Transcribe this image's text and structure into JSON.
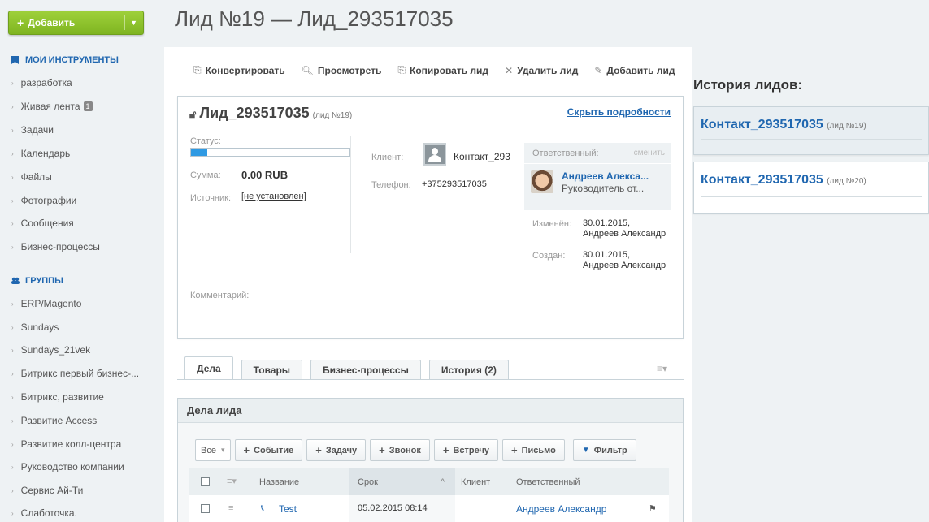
{
  "sidebar": {
    "add_label": "Добавить",
    "my_tools_label": "МОИ ИНСТРУМЕНТЫ",
    "tools": [
      "разработка",
      "Живая лента",
      "Задачи",
      "Календарь",
      "Файлы",
      "Фотографии",
      "Сообщения",
      "Бизнес-процессы"
    ],
    "feed_badge": "1",
    "groups_label": "ГРУППЫ",
    "groups": [
      "ERP/Magento",
      "Sundays",
      "Sundays_21vek",
      "Битрикс первый бизнес-...",
      "Битрикс, развитие",
      "Развитие Access",
      "Развитие колл-центра",
      "Руководство компании",
      "Сервис Ай-Ти",
      "Слаботочка."
    ]
  },
  "header": {
    "title": "Лид №19 — Лид_293517035"
  },
  "toolbar": {
    "convert": "Конвертировать",
    "view": "Просмотреть",
    "copy": "Копировать лид",
    "delete": "Удалить лид",
    "add": "Добавить лид"
  },
  "lead": {
    "name": "Лид_293517035",
    "number": "(лид №19)",
    "hide_details": "Скрыть подробности",
    "status_label": "Статус:",
    "status_progress": 0.1,
    "sum_label": "Сумма:",
    "sum_value": "0.00 RUB",
    "source_label": "Источник:",
    "source_value": "[не установлен]",
    "client_label": "Клиент:",
    "client_value": "Контакт_293",
    "phone_label": "Телефон:",
    "phone_value": "+375293517035",
    "responsible_label": "Ответственный:",
    "change_label": "сменить",
    "responsible_name": "Андреев Алекса...",
    "responsible_position": "Руководитель от...",
    "modified_label": "Изменён:",
    "modified_date": "30.01.2015,",
    "modified_by": "Андреев Александр",
    "created_label": "Создан:",
    "created_date": "30.01.2015,",
    "created_by": "Андреев Александр",
    "comment_label": "Комментарий:"
  },
  "tabs": [
    "Дела",
    "Товары",
    "Бизнес-процессы",
    "История (2)"
  ],
  "activities": {
    "title": "Дела лида",
    "filter_value": "Все",
    "buttons": [
      "Событие",
      "Задачу",
      "Звонок",
      "Встречу",
      "Письмо"
    ],
    "filter_button": "Фильтр",
    "columns": [
      "Название",
      "Срок",
      "Клиент",
      "Ответственный"
    ],
    "rows": [
      {
        "name": "Test",
        "due": "05.02.2015 08:14",
        "client": "",
        "responsible": "Андреев Александр"
      }
    ]
  },
  "history": {
    "title": "История лидов:",
    "items": [
      {
        "name": "Контакт_293517035",
        "number": "(лид №19)"
      },
      {
        "name": "Контакт_293517035",
        "number": "(лид №20)"
      }
    ]
  }
}
